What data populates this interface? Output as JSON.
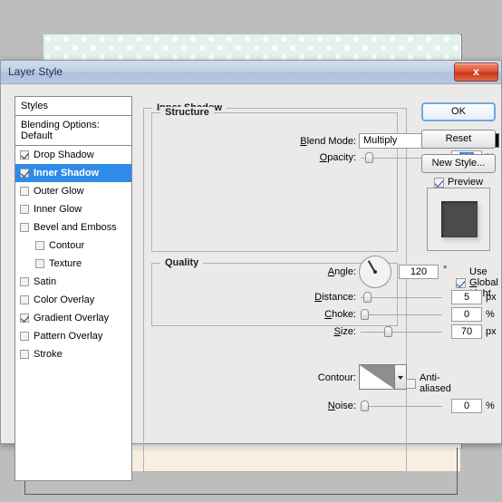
{
  "background": {
    "top_band_color": "#e3f2ec",
    "bottom_band_color": "#f7f0e0",
    "canvas_color": "#ffffff"
  },
  "dialog": {
    "title": "Layer Style",
    "close_label": "x",
    "accent_color": "#2e8bea",
    "titlebar_color": "#b9c8e0",
    "body_color": "#eceae8"
  },
  "styles_panel": {
    "header": "Styles",
    "blending_options": "Blending Options: Default",
    "items": [
      {
        "label": "Drop Shadow",
        "checked": true,
        "selected": false,
        "indent": false
      },
      {
        "label": "Inner Shadow",
        "checked": true,
        "selected": true,
        "indent": false
      },
      {
        "label": "Outer Glow",
        "checked": false,
        "selected": false,
        "indent": false
      },
      {
        "label": "Inner Glow",
        "checked": false,
        "selected": false,
        "indent": false
      },
      {
        "label": "Bevel and Emboss",
        "checked": false,
        "selected": false,
        "indent": false
      },
      {
        "label": "Contour",
        "checked": false,
        "selected": false,
        "indent": true
      },
      {
        "label": "Texture",
        "checked": false,
        "selected": false,
        "indent": true
      },
      {
        "label": "Satin",
        "checked": false,
        "selected": false,
        "indent": false
      },
      {
        "label": "Color Overlay",
        "checked": false,
        "selected": false,
        "indent": false
      },
      {
        "label": "Gradient Overlay",
        "checked": true,
        "selected": false,
        "indent": false
      },
      {
        "label": "Pattern Overlay",
        "checked": false,
        "selected": false,
        "indent": false
      },
      {
        "label": "Stroke",
        "checked": false,
        "selected": false,
        "indent": false
      }
    ]
  },
  "main": {
    "section_title": "Inner Shadow",
    "structure": {
      "legend": "Structure",
      "blend_mode_label": "Blend Mode:",
      "blend_mode_value": "Multiply",
      "color_swatch": "#000000",
      "opacity_label": "Opacity:",
      "opacity_value": "11",
      "opacity_unit": "%",
      "angle_label": "Angle:",
      "angle_value": "120",
      "angle_unit": "°",
      "use_global_light_label": "Use Global Light",
      "use_global_light_checked": true,
      "distance_label": "Distance:",
      "distance_value": "5",
      "distance_unit": "px",
      "choke_label": "Choke:",
      "choke_value": "0",
      "choke_unit": "%",
      "size_label": "Size:",
      "size_value": "70",
      "size_unit": "px"
    },
    "quality": {
      "legend": "Quality",
      "contour_label": "Contour:",
      "anti_aliased_label": "Anti-aliased",
      "anti_aliased_checked": false,
      "noise_label": "Noise:",
      "noise_value": "0",
      "noise_unit": "%"
    }
  },
  "buttons": {
    "ok": "OK",
    "reset": "Reset",
    "new_style": "New Style...",
    "preview_label": "Preview",
    "preview_checked": true
  }
}
